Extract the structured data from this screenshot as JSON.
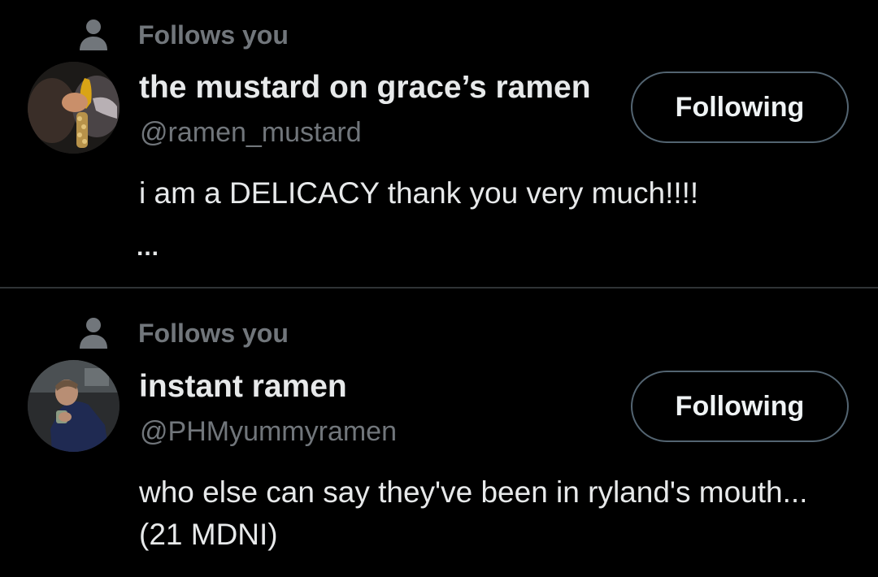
{
  "users": [
    {
      "follows_label": "Follows you",
      "display_name": "the mustard on grace’s ramen",
      "handle": "@ramen_mustard",
      "button_label": "Following",
      "bio": "i am a DELICACY thank you very much!!!!",
      "more": "..."
    },
    {
      "follows_label": "Follows you",
      "display_name": "instant ramen",
      "handle": "@PHMyummyramen",
      "button_label": "Following",
      "bio": "who else can say they've been in ryland's mouth... (21 MDNI)"
    }
  ],
  "colors": {
    "background": "#000000",
    "primary_text": "#e7e9ea",
    "secondary_text": "#71767b",
    "button_border": "#536471",
    "divider": "#2f3336"
  },
  "icons": {
    "follows_indicator": "person-icon"
  }
}
